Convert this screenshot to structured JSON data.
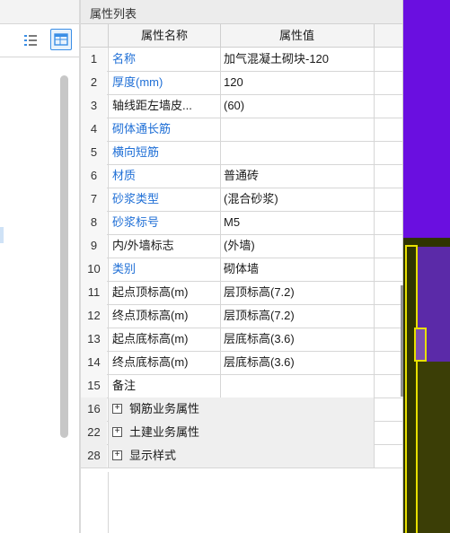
{
  "panel": {
    "title": "属性列表",
    "columns": {
      "name": "属性名称",
      "value": "属性值"
    }
  },
  "rows": [
    {
      "num": "1",
      "name": "名称",
      "value": "加气混凝土砌块-120",
      "blue": true
    },
    {
      "num": "2",
      "name": "厚度(mm)",
      "value": "120",
      "blue": true
    },
    {
      "num": "3",
      "name": "轴线距左墙皮...",
      "value": "(60)",
      "blue": false
    },
    {
      "num": "4",
      "name": "砌体通长筋",
      "value": "",
      "blue": true
    },
    {
      "num": "5",
      "name": "横向短筋",
      "value": "",
      "blue": true
    },
    {
      "num": "6",
      "name": "材质",
      "value": "普通砖",
      "blue": true
    },
    {
      "num": "7",
      "name": "砂浆类型",
      "value": "(混合砂浆)",
      "blue": true
    },
    {
      "num": "8",
      "name": "砂浆标号",
      "value": "M5",
      "blue": true
    },
    {
      "num": "9",
      "name": "内/外墙标志",
      "value": "(外墙)",
      "blue": false
    },
    {
      "num": "10",
      "name": "类别",
      "value": "砌体墙",
      "blue": true
    },
    {
      "num": "11",
      "name": "起点顶标高(m)",
      "value": "层顶标高(7.2)",
      "blue": false
    },
    {
      "num": "12",
      "name": "终点顶标高(m)",
      "value": "层顶标高(7.2)",
      "blue": false
    },
    {
      "num": "13",
      "name": "起点底标高(m)",
      "value": "层底标高(3.6)",
      "blue": false
    },
    {
      "num": "14",
      "name": "终点底标高(m)",
      "value": "层底标高(3.6)",
      "blue": false
    },
    {
      "num": "15",
      "name": "备注",
      "value": "",
      "blue": false
    }
  ],
  "groups": [
    {
      "num": "16",
      "name": "钢筋业务属性",
      "expand": "+"
    },
    {
      "num": "22",
      "name": "土建业务属性",
      "expand": "+"
    },
    {
      "num": "28",
      "name": "显示样式",
      "expand": "+"
    }
  ],
  "icons": {
    "list_view": "list-icon",
    "table_view": "table-view-icon"
  },
  "colors": {
    "blue_label": "#1f6fd6",
    "viewport_purple": "#6a0fe0",
    "viewport_yellow": "#e8e000"
  }
}
